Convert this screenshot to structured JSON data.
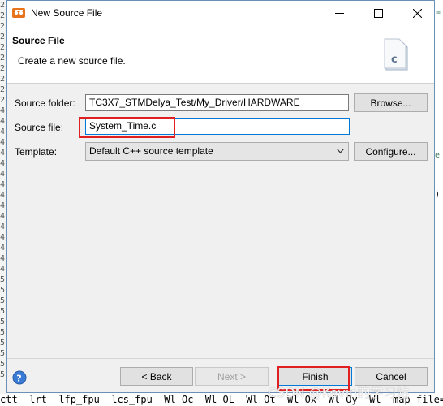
{
  "window": {
    "title": "New Source File"
  },
  "header": {
    "title": "Source File",
    "description": "Create a new source file.",
    "icon": "c-source-file-icon"
  },
  "form": {
    "source_folder": {
      "label": "Source folder:",
      "value": "TC3X7_STMDelya_Test/My_Driver/HARDWARE",
      "browse_label": "Browse..."
    },
    "source_file": {
      "label": "Source file:",
      "value": "System_Time.c"
    },
    "template": {
      "label": "Template:",
      "selected": "Default C++ source template",
      "configure_label": "Configure..."
    }
  },
  "buttons": {
    "back": "< Back",
    "next": "Next >",
    "finish": "Finish",
    "cancel": "Cancel"
  },
  "background": {
    "left_gutter_chars": [
      "2",
      "2",
      "2",
      "2",
      "2",
      "2",
      "2",
      "2",
      "2",
      "2",
      "4",
      "4",
      "4",
      "4",
      "4",
      "4",
      "4",
      "4",
      "4",
      "4",
      "4",
      "4",
      "4",
      "4",
      "4",
      "4",
      "5",
      "5",
      "5",
      "5",
      "5",
      "5",
      "5",
      "5",
      "5",
      "5"
    ],
    "bottom_line": "ctt -lrt -lfp_fpu -lcs_fpu  -Wl-Oc -Wl-OL -Wl-Ot -Wl-Ox -Wl-Oy -Wl--map-file= -"
  },
  "watermark": "CSDN @Kevin的学习站",
  "colors": {
    "highlight": "#e02020",
    "focus": "#0078d7"
  }
}
